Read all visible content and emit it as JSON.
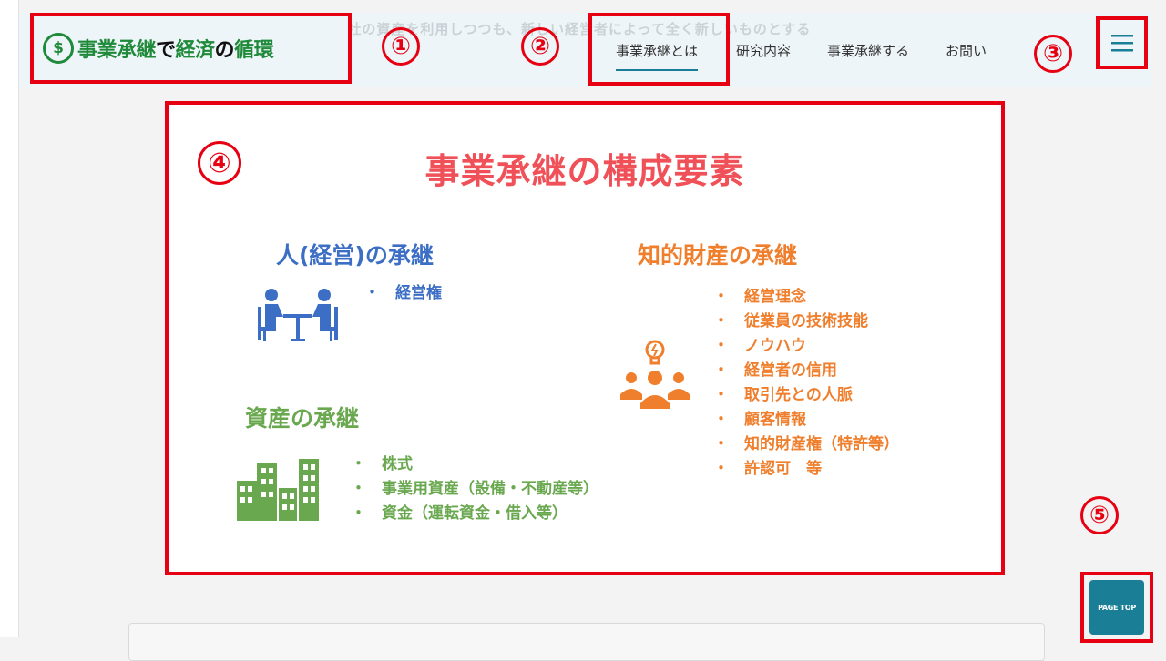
{
  "header": {
    "background_text": "つまり、事業承継は、今ある会社の資産を利用しつつも、新しい経営者によって全く新しいものとする",
    "logo": {
      "mark": "$",
      "part1": "事業承継",
      "part2": "で",
      "part3": "経済",
      "part4": "の",
      "part5": "循環"
    },
    "nav": [
      "事業承継とは",
      "研究内容",
      "事業承継する",
      "お問い"
    ],
    "menu_icon": "hamburger-icon"
  },
  "annotations": [
    "①",
    "②",
    "③",
    "④",
    "⑤"
  ],
  "slide": {
    "title": "事業承継の構成要素",
    "people": {
      "title": "人(経営)の承継",
      "items": [
        "経営権"
      ],
      "icon": "meeting-icon"
    },
    "assets": {
      "title": "資産の承継",
      "items": [
        "株式",
        "事業用資産（設備・不動産等）",
        "資金（運転資金・借入等）"
      ],
      "icon": "buildings-icon"
    },
    "ip": {
      "title": "知的財産の承継",
      "items": [
        "経営理念",
        "従業員の技術技能",
        "ノウハウ",
        "経営者の信用",
        "取引先との人脈",
        "顧客情報",
        "知的財産権（特許等）",
        "許認可　等"
      ],
      "icon": "team-idea-icon"
    }
  },
  "page_top": {
    "label": "PAGE TOP"
  },
  "colors": {
    "accent_red": "#e60012",
    "title_red": "#f05058",
    "blue": "#3b6ec4",
    "green": "#6aa84f",
    "orange": "#ef7f2d",
    "teal": "#1a7f96",
    "logo_green": "#1f8a3a"
  }
}
